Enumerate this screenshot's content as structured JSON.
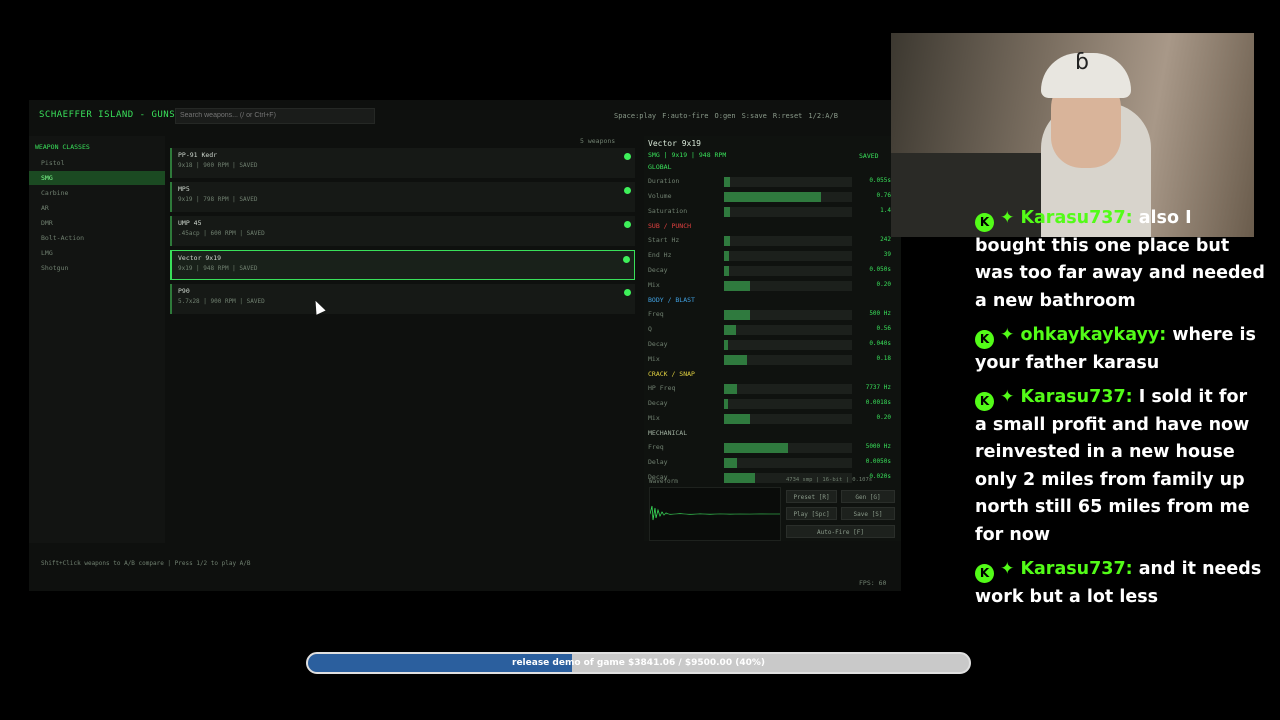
{
  "app": {
    "title": "SCHAEFFER ISLAND - GUNS",
    "search_placeholder": "Search weapons... (/ or Ctrl+F)",
    "hotkeys": [
      "Space:play",
      "F:auto-fire",
      "O:gen",
      "S:save",
      "R:reset",
      "1/2:A/B"
    ],
    "footer": "Shift+Click weapons to A/B compare  |  Press 1/2 to play A/B",
    "fps": "FPS: 60"
  },
  "sidebar": {
    "title": "WEAPON CLASSES",
    "classes": [
      "Pistol",
      "SMG",
      "Carbine",
      "AR",
      "DMR",
      "Bolt-Action",
      "LMG",
      "Shotgun"
    ],
    "active_class": "SMG"
  },
  "weapon_list": {
    "count": "5 weapons",
    "items": [
      {
        "name": "PP-91 Kedr",
        "info": "9x18  |  900 RPM  |  SAVED"
      },
      {
        "name": "MP5",
        "info": "9x19  |  798 RPM  |  SAVED"
      },
      {
        "name": "UMP 45",
        "info": ".45acp  |  600 RPM  |  SAVED"
      },
      {
        "name": "Vector 9x19",
        "info": "9x19  |  948 RPM  |  SAVED"
      },
      {
        "name": "P90",
        "info": "5.7x28  |  900 RPM  |  SAVED"
      }
    ],
    "selected": "Vector 9x19"
  },
  "detail": {
    "name": "Vector 9x19",
    "sub": "SMG  |  9x19  |  948 RPM",
    "saved": "SAVED",
    "sections": [
      {
        "title": "GLOBAL",
        "color": "#39e05a",
        "rows": [
          {
            "label": "Duration",
            "value": "0.055s",
            "level": 0.05
          },
          {
            "label": "Volume",
            "value": "0.76",
            "level": 0.76
          },
          {
            "label": "Saturation",
            "value": "1.4",
            "level": 0.05
          }
        ]
      },
      {
        "title": "SUB / PUNCH",
        "color": "#e04040",
        "rows": [
          {
            "label": "Start Hz",
            "value": "242",
            "level": 0.05
          },
          {
            "label": "End Hz",
            "value": "39",
            "level": 0.04
          },
          {
            "label": "Decay",
            "value": "0.050s",
            "level": 0.04
          },
          {
            "label": "Mix",
            "value": "0.20",
            "level": 0.2
          }
        ]
      },
      {
        "title": "BODY / BLAST",
        "color": "#40a0e0",
        "rows": [
          {
            "label": "Freq",
            "value": "500 Hz",
            "level": 0.2
          },
          {
            "label": "Q",
            "value": "0.56",
            "level": 0.09
          },
          {
            "label": "Decay",
            "value": "0.040s",
            "level": 0.03
          },
          {
            "label": "Mix",
            "value": "0.18",
            "level": 0.18
          }
        ]
      },
      {
        "title": "CRACK / SNAP",
        "color": "#e0d040",
        "rows": [
          {
            "label": "HP Freq",
            "value": "7737 Hz",
            "level": 0.1
          },
          {
            "label": "Decay",
            "value": "0.0018s",
            "level": 0.03
          },
          {
            "label": "Mix",
            "value": "0.20",
            "level": 0.2
          }
        ]
      },
      {
        "title": "MECHANICAL",
        "color": "#a0b0a0",
        "rows": [
          {
            "label": "Freq",
            "value": "5000 Hz",
            "level": 0.5
          },
          {
            "label": "Delay",
            "value": "0.0050s",
            "level": 0.1
          },
          {
            "label": "Decay",
            "value": "0.020s",
            "level": 0.24
          }
        ]
      }
    ],
    "waveform_label": "Waveform",
    "sample_info": "4734 smp | 16-bit | 0.107s",
    "buttons": {
      "preset": "Preset [R]",
      "gen": "Gen [G]",
      "play": "Play [Spc]",
      "save": "Save [S]",
      "autofire": "Auto-Fire [F]"
    }
  },
  "chat": [
    {
      "user": "Karasu737",
      "text": "also I bought this one place but was too far away and needed a new bathroom"
    },
    {
      "user": "ohkaykaykayy",
      "text": "where is your father karasu"
    },
    {
      "user": "Karasu737",
      "text": "I sold it for a small profit and have now reinvested in a new house only 2 miles from family up north still 65 miles from me for now"
    },
    {
      "user": "Karasu737",
      "text": "and it needs work but a lot less"
    }
  ],
  "goal": {
    "text": "release demo of game $3841.06 / $9500.00 (40%)",
    "progress": 0.4
  }
}
